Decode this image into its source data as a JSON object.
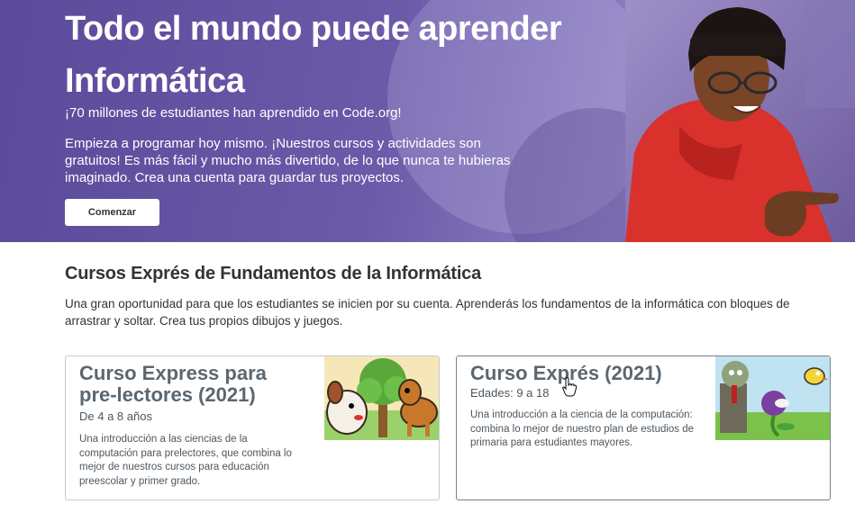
{
  "hero": {
    "title": "Todo el mundo puede aprender Informática",
    "stat": "¡70 millones de estudiantes han aprendido en Code.org!",
    "description": "Empieza a programar hoy mismo. ¡Nuestros cursos y actividades son gratuitos! Es más fácil y mucho más divertido, de lo que nunca te hubieras imaginado. Crea una cuenta para guardar tus proyectos.",
    "button_label": "Comenzar"
  },
  "section": {
    "title": "Cursos Exprés de Fundamentos de la Informática",
    "description": "Una gran oportunidad para que los estudiantes se inicien por su cuenta. Aprenderás los fundamentos de la informática con bloques de arrastrar y soltar. Crea tus propios dibujos y juegos."
  },
  "cards": [
    {
      "title": "Curso Express para pre-lectores (2021)",
      "age": "De 4 a 8 años",
      "description": "Una introducción a las ciencias de la computación para prelectores, que combina lo mejor de nuestros cursos para educación preescolar y primer grado."
    },
    {
      "title": "Curso Exprés (2021)",
      "age": "Edades: 9 a 18",
      "description": "Una introducción a la ciencia de la computación: combina lo mejor de nuestro plan de estudios de primaria para estudiantes mayores."
    }
  ],
  "colors": {
    "hero_purple": "#5b4a9a",
    "card_title": "#5b6770",
    "text": "#333333"
  }
}
